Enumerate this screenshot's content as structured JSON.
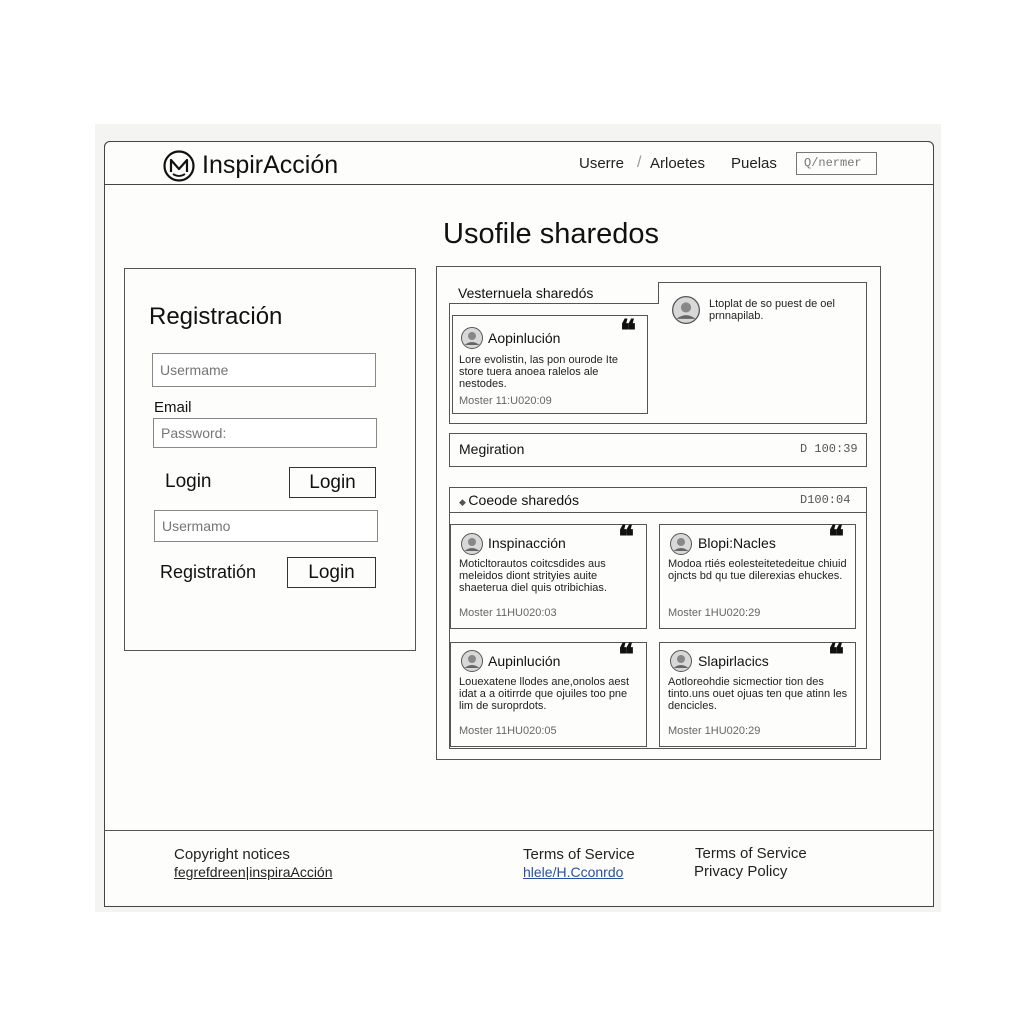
{
  "header": {
    "brand": "InspirAcción",
    "nav": [
      "Userre",
      "Arloetes",
      "Puelas"
    ],
    "nav_separator": "/",
    "search_placeholder": "Q/nermer"
  },
  "page_title": "Usofile sharedos",
  "registration": {
    "title": "Registración",
    "username_placeholder": "Usermame",
    "email_label": "Email",
    "password_placeholder": "Password:",
    "login_label": "Login",
    "login_button": "Login",
    "username2_placeholder": "Usermamo",
    "registration_label": "Registratión",
    "login_button_2": "Login"
  },
  "shared": {
    "section1_title": "Vesternuela sharedós",
    "featured_card": {
      "name": "Aopinlución",
      "body": "Lore evolistin, las pon ourode Ite store tuera anoea ralelos ale nestodes.",
      "time": "Moster 11:U020:09"
    },
    "profile_note": "Ltoplat de so puest de oel prnnapilab.",
    "section2_title": "Megiration",
    "section2_time": "D 100:39",
    "section3_title": "Coeode sharedós",
    "section3_time": "D100:04",
    "cards": [
      {
        "name": "Inspinacción",
        "body": "Moticltorautos coitcsdides aus meleidos diont strityies auite shaeterua diel quis otribichias.",
        "time": "Moster 11HU020:03"
      },
      {
        "name": "Blopi:Nacles",
        "body": "Modoa rtiés eolesteitetedeitue chiuid ojncts bd qu tue dilerexias ehuckes.",
        "time": "Moster 1HU020:29"
      },
      {
        "name": "Aupinlución",
        "body": "Louexatene llodes ane,onolos aest idat a a oitirrde que ojuiles too pne lim de suroprdots.",
        "time": "Moster 11HU020:05"
      },
      {
        "name": "Slapirlacics",
        "body": "Aotloreohdie sicmectior tion des tinto.uns ouet ojuas ten que atinn les dencicles.",
        "time": "Moster 1HU020:29"
      }
    ]
  },
  "footer": {
    "copyright": "Copyright notices",
    "copyright_link": "fegrefdreen|inspiraAcción",
    "terms": "Terms of Service",
    "terms_link": "hlele/H.Cconrdo",
    "terms2": "Terms of Service",
    "privacy": "Privacy Policy"
  },
  "colors": {
    "link": "#2d4fa0",
    "border": "#444444",
    "background": "#fdfdfc"
  }
}
